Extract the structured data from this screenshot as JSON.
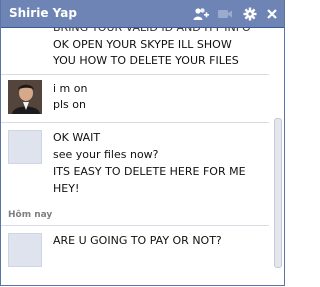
{
  "header": {
    "contact_name": "Shirie Yap",
    "icons": [
      "add-friends-icon",
      "video-call-icon",
      "settings-gear-icon",
      "close-icon"
    ]
  },
  "conversation": {
    "block1": {
      "cut_line": "BRING YOUR VALID ID AND ITT INFO",
      "lines": [
        "OK OPEN YOUR SKYPE ILL SHOW",
        "YOU HOW TO DELETE YOUR FILES"
      ]
    },
    "block2": {
      "lines": [
        "i m on",
        "pls on"
      ]
    },
    "block3": {
      "lines": [
        "OK WAIT",
        "see your files now?",
        "ITS EASY TO DELETE HERE FOR ME",
        "HEY!"
      ]
    },
    "date_separator": "Hôm nay",
    "block4": {
      "lines": [
        "ARE U GOING TO PAY OR NOT?"
      ]
    }
  },
  "colors": {
    "titlebar": "#6d84b4",
    "titlebar_border": "#3b5998",
    "text": "#111111"
  }
}
